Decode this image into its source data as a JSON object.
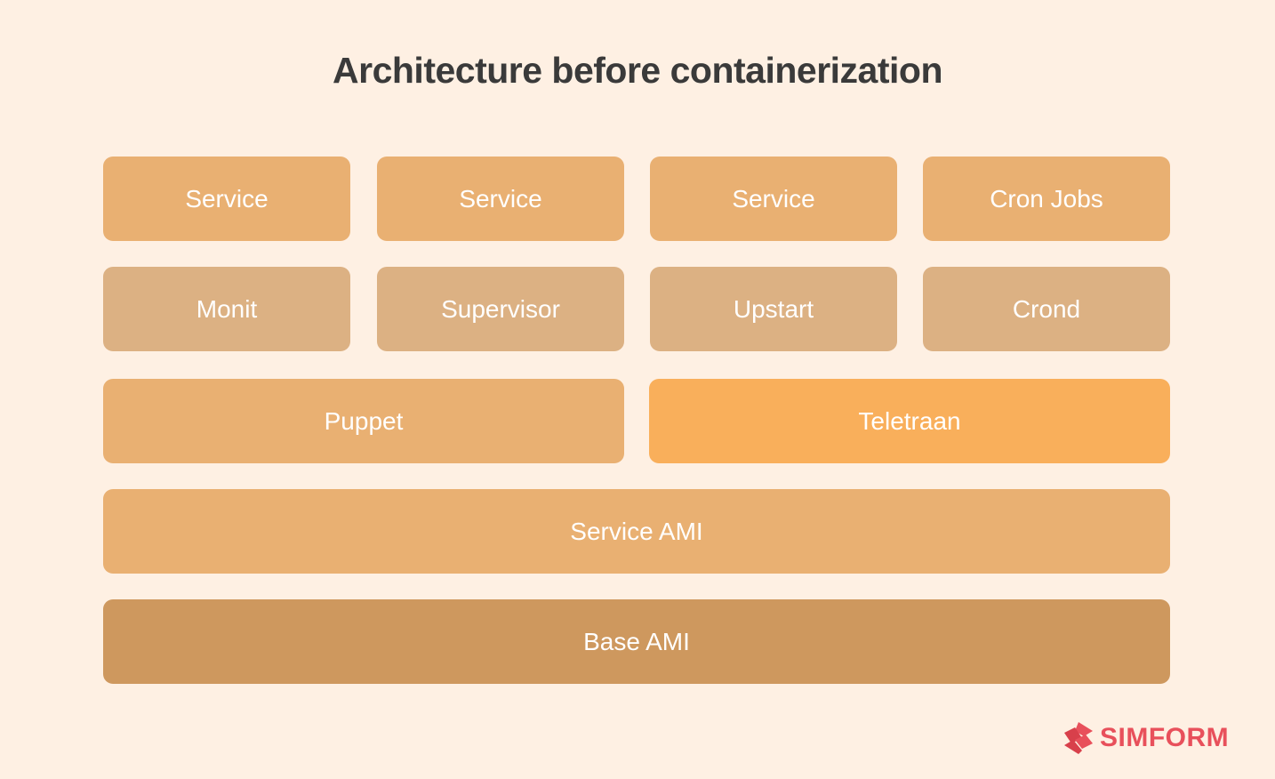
{
  "title": "Architecture before containerization",
  "rows": {
    "services": [
      "Service",
      "Service",
      "Service",
      "Cron Jobs"
    ],
    "process_managers": [
      "Monit",
      "Supervisor",
      "Upstart",
      "Crond"
    ],
    "deployment": [
      "Puppet",
      "Teletraan"
    ],
    "service_ami": "Service AMI",
    "base_ami": "Base AMI"
  },
  "colors": {
    "background": "#fef0e3",
    "service": "#e9b072",
    "process_manager": "#dcb183",
    "teletraan": "#f9af5b",
    "base_ami": "#ce985e",
    "brand": "#e8505b"
  },
  "logo": {
    "icon": "simform-logo-icon",
    "text": "SIMFORM"
  }
}
